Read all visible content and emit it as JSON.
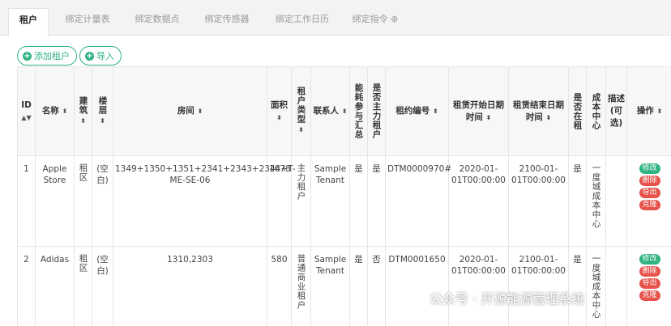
{
  "tabs": [
    {
      "label": "租户",
      "active": true
    },
    {
      "label": "绑定计量表"
    },
    {
      "label": "绑定数据点"
    },
    {
      "label": "绑定传感器"
    },
    {
      "label": "绑定工作日历"
    },
    {
      "label": "绑定指令 ⊕"
    }
  ],
  "toolbar": {
    "add_label": "添加租户",
    "import_label": "导入"
  },
  "table": {
    "headers": {
      "id": "ID",
      "name": "名称",
      "building": "建筑",
      "floor": "楼层",
      "room": "房间",
      "area": "面积",
      "tenant_type": "租户类型",
      "contact": "联系人",
      "energy_summary": "能耗参与汇总",
      "main_tenant": "是否主力租户",
      "lease_no": "租约编号",
      "lease_start": "租赁开始日期时间",
      "lease_end": "租赁结束日期时间",
      "is_leased": "是否在租",
      "cost_center": "成本中心",
      "description": "描述(可选)",
      "actions": "操作"
    },
    "rows": [
      {
        "id": "1",
        "name": "Apple Store",
        "building": "租区",
        "floor": "(空白)",
        "room": "1349+1350+1351+2341+2343+2344+T-ME-SE-06",
        "area": "1678",
        "tenant_type": "主力租户",
        "contact": "Sample Tenant",
        "energy_summary": "是",
        "main_tenant": "是",
        "lease_no": "DTM0000970#",
        "lease_start": "2020-01-01T00:00:00",
        "lease_end": "2100-01-01T00:00:00",
        "is_leased": "是",
        "cost_center": "一度城成本中心",
        "description": ""
      },
      {
        "id": "2",
        "name": "Adidas",
        "building": "租区",
        "floor": "(空白)",
        "room": "1310,2303",
        "area": "580",
        "tenant_type": "普通商业租户",
        "contact": "Sample Tenant",
        "energy_summary": "是",
        "main_tenant": "否",
        "lease_no": "DTM0001650",
        "lease_start": "2020-01-01T00:00:00",
        "lease_end": "2100-01-01T00:00:00",
        "is_leased": "是",
        "cost_center": "一度城成本中心",
        "description": ""
      }
    ],
    "action_labels": {
      "edit": "修改",
      "delete": "删除",
      "export": "导出",
      "clone": "克隆"
    }
  },
  "watermark": {
    "text": "公众号 · 开源能源管理系统",
    "icon": "wechat-icon"
  },
  "colors": {
    "accent": "#2fb380",
    "danger": "#e5534b"
  }
}
